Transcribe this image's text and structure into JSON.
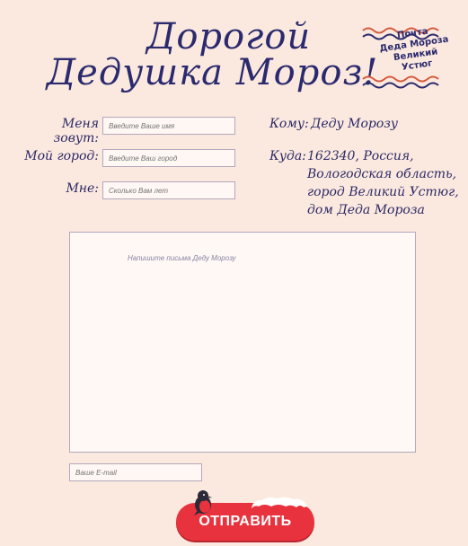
{
  "title": {
    "line1": "Дорогой",
    "line2": "Дедушка Мороз!"
  },
  "stamp": {
    "line1": "Почта",
    "line2": "Деда Мороза",
    "line3": "Великий Устюг"
  },
  "form": {
    "name_label": "Меня зовут:",
    "name_placeholder": "Введите Ваше имя",
    "city_label": "Мой город:",
    "city_placeholder": "Введите Ваш город",
    "age_label": "Мне:",
    "age_placeholder": "Сколько Вам лет",
    "letter_placeholder": "Напишите письма Деду Морозу",
    "email_placeholder": "Ваше E-mail",
    "send_label": "ОТПРАВИТЬ"
  },
  "address": {
    "to_label": "Кому:",
    "to_value": "Деду Морозу",
    "where_label": "Куда:",
    "where_lines": [
      "162340, Россия,",
      "Вологодская область,",
      "город Великий Устюг,",
      "дом Деда Мороза"
    ]
  },
  "colors": {
    "background": "#fbe9df",
    "ink": "#2d2a66",
    "button": "#e8333f"
  },
  "icons": {
    "mascot": "bullfinch-icon"
  }
}
